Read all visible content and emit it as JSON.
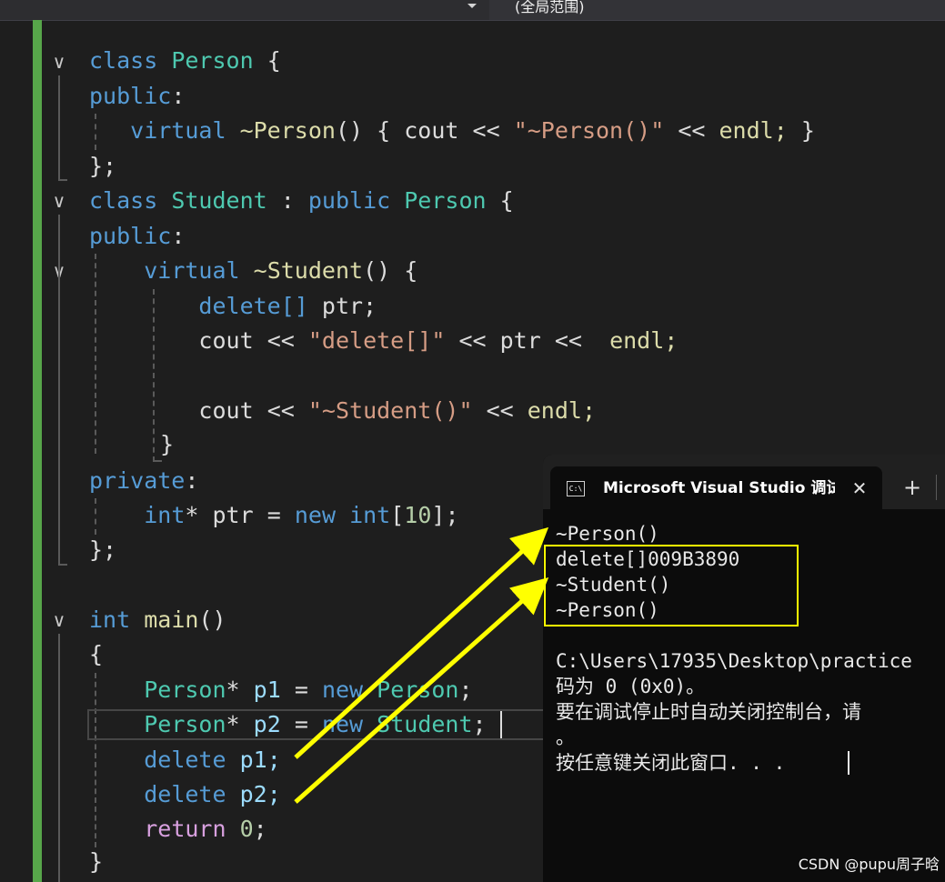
{
  "toolbar": {
    "scope_label": "(全局范围)"
  },
  "code": {
    "tokens": {
      "class": "class",
      "Person": "Person",
      "brace_open": "{",
      "public": "public",
      "colon": ":",
      "virtual": "virtual",
      "dtor_person": "~Person",
      "parens": "()",
      "cout": "cout",
      "shl": "<<",
      "str_person_dtor": "\"~Person()\"",
      "endl_semi": "endl;",
      "brace_close": "}",
      "close_semi": "};",
      "Student": "Student",
      "colon_sep": ":",
      "dtor_student": "~Student",
      "delete": "delete",
      "brackets": "[]",
      "ptr_semi": "ptr;",
      "str_delete": "\"delete[]\"",
      "ptr": "ptr",
      "str_student_dtor": "\"~Student()\"",
      "private": "private",
      "int": "int",
      "star": "*",
      "eq": "=",
      "new": "new",
      "lbracket": "[",
      "ten": "10",
      "rbracket_semi": "];",
      "main": "main",
      "p1": "p1",
      "p2": "p2",
      "semi": ";",
      "delete_p1_tail": "p1;",
      "delete_p2_tail": "p2;",
      "return": "return",
      "zero": "0"
    }
  },
  "console": {
    "tab_title": "Microsoft Visual Studio 调试控制台",
    "icon_text": "C:\\",
    "lines": [
      "~Person()",
      "delete[]009B3890",
      "~Student()",
      "~Person()",
      "",
      "C:\\Users\\17935\\Desktop\\practice",
      "码为 0 (0x0)。",
      "要在调试停止时自动关闭控制台，请",
      "。",
      "按任意键关闭此窗口. . ."
    ]
  },
  "annotation": {
    "arrow_color": "#ffff00"
  },
  "watermark": {
    "text": "CSDN @pupu周子晗"
  }
}
